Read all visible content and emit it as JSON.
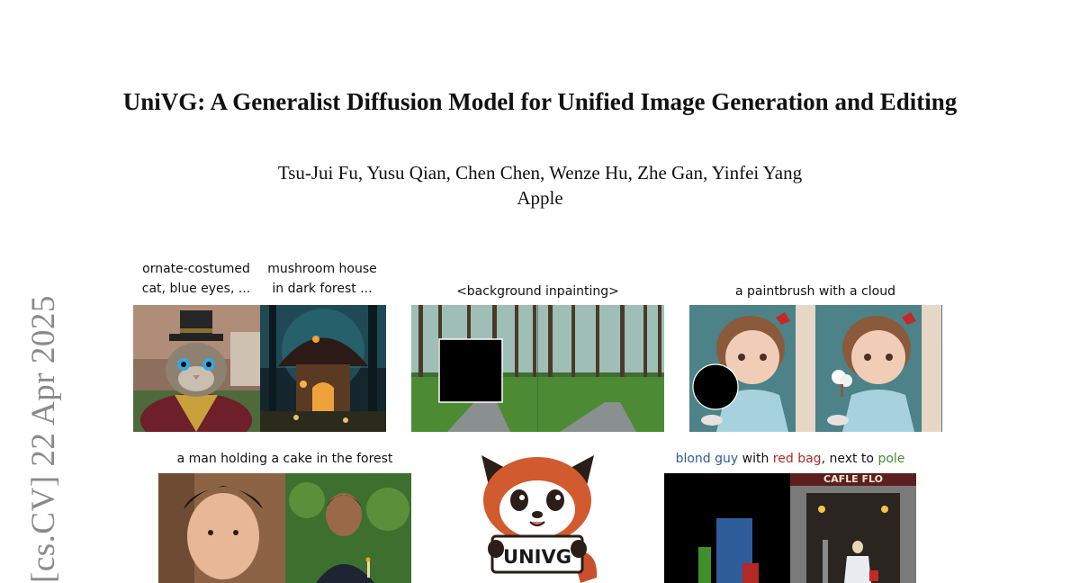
{
  "side_stamp": "[cs.CV]   22 Apr 2025",
  "title": "UniVG: A Generalist Diffusion Model for Unified Image Generation and Editing",
  "authors": "Tsu-Jui Fu, Yusu Qian, Chen Chen, Wenze Hu, Zhe Gan, Yinfei Yang",
  "affiliation": "Apple",
  "figure": {
    "caption_cat_1": "ornate-costumed",
    "caption_cat_2": "cat, blue eyes, ...",
    "caption_house_1": "mushroom house",
    "caption_house_2": "in dark forest ...",
    "caption_inpaint": "<background inpainting>",
    "caption_paintbrush": "a paintbrush with a cloud",
    "caption_man": "a man holding a cake in the forest",
    "caption_layout_blond": "blond guy",
    "caption_layout_with": " with ",
    "caption_layout_redbag": "red bag",
    "caption_layout_next": ", next to ",
    "caption_layout_pole": "pole",
    "mascot_sign": "UNIVG",
    "storefront_sign": "CAFLE FLO"
  },
  "colors": {
    "layout_blue": "#2f5d9a",
    "layout_red": "#b32a24",
    "layout_green": "#3f8f2f"
  }
}
